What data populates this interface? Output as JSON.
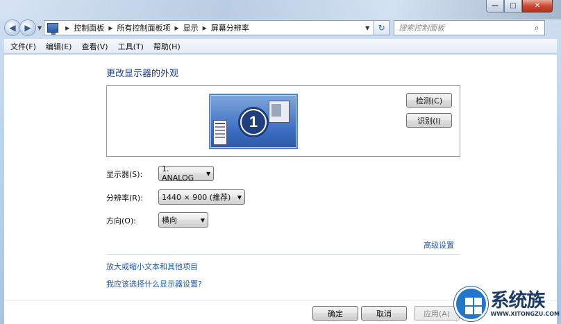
{
  "window": {
    "min_label": "—",
    "max_label": "□",
    "close_label": "✕"
  },
  "nav": {
    "back_glyph": "◀",
    "forward_glyph": "▶",
    "dropdown_glyph": "▼",
    "breadcrumb": [
      "控制面板",
      "所有控制面板项",
      "显示",
      "屏幕分辨率"
    ],
    "separator": "▶",
    "refresh_glyph": "↻",
    "search_placeholder": "搜索控制面板",
    "search_glyph": "⌕"
  },
  "menubar": {
    "items": [
      "文件(F)",
      "编辑(E)",
      "查看(V)",
      "工具(T)",
      "帮助(H)"
    ]
  },
  "main": {
    "title": "更改显示器的外观",
    "monitor_number": "1",
    "detect_button": "检测(C)",
    "identify_button": "识别(I)",
    "display_label": "显示器(S):",
    "display_value": "1. ANALOG",
    "resolution_label": "分辨率(R):",
    "resolution_value": "1440 × 900 (推荐)",
    "orientation_label": "方向(O):",
    "orientation_value": "横向",
    "combo_arrow": "▼",
    "advanced_link": "高级设置",
    "link_text_size": "放大或缩小文本和其他项目",
    "link_which_settings": "我应该选择什么显示器设置?",
    "ok_button": "确定",
    "cancel_button": "取消",
    "apply_button": "应用(A)"
  },
  "watermark": {
    "cn": "系统族",
    "en": "WWW.XITONGZU.COM"
  },
  "colors": {
    "link": "#1e5ab4",
    "title": "#1e3e8a",
    "close_button": "#c84b35"
  }
}
